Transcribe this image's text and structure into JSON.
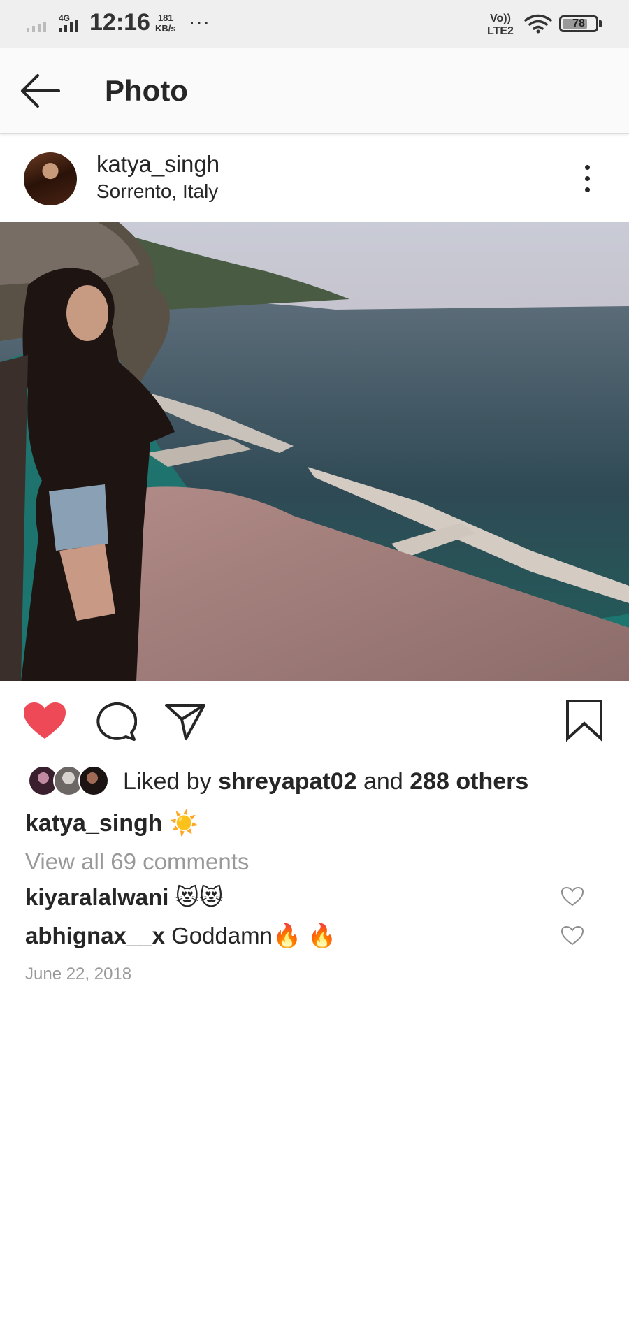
{
  "status_bar": {
    "network": "4G",
    "time": "12:16",
    "speed_value": "181",
    "speed_unit": "KB/s",
    "dots": "···",
    "volte_top": "Vo))",
    "volte_bottom": "LTE2",
    "battery": "78",
    "battery_level": 0.78,
    "icons": [
      "signal-icon",
      "wifi-icon",
      "battery-icon"
    ]
  },
  "header": {
    "title": "Photo",
    "back_icon": "arrow-left-icon"
  },
  "post": {
    "username": "katya_singh",
    "location": "Sorrento, Italy",
    "photo_description_icon": "post-photo",
    "actions": {
      "liked": true,
      "like_color": "#ed4956",
      "icons": [
        "heart-icon",
        "comment-icon",
        "share-icon",
        "bookmark-icon"
      ]
    },
    "likes": {
      "prefix": "Liked by",
      "user": "shreyapat02",
      "conj": "and",
      "others": "288 others"
    },
    "caption": {
      "username": "katya_singh",
      "emoji": "☀️"
    },
    "view_comments": "View all 69 comments",
    "comments": [
      {
        "username": "kiyaralalwani",
        "text": "😻😻"
      },
      {
        "username": "abhignax__x",
        "text": "Goddamn🔥 🔥"
      }
    ],
    "date": "June 22, 2018"
  }
}
